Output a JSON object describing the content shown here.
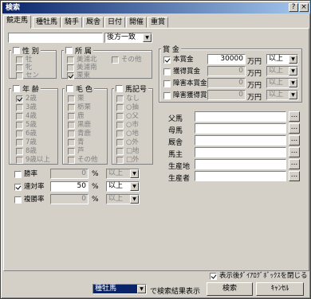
{
  "window": {
    "title": "検索"
  },
  "tabs": [
    {
      "label": "競走馬",
      "active": true
    },
    {
      "label": "種牡馬"
    },
    {
      "label": "騎手"
    },
    {
      "label": "厩舎"
    },
    {
      "label": "日付"
    },
    {
      "label": "開催"
    },
    {
      "label": "重賞"
    }
  ],
  "name_search": {
    "value": "",
    "match_mode": "後方一致"
  },
  "sex": {
    "title": "性 別",
    "items": [
      "牡",
      "牝",
      "セン"
    ]
  },
  "region": {
    "title": "所 属",
    "items": [
      "美浦北",
      "美浦南",
      "栗東",
      "その他"
    ],
    "checked": [
      "栗東"
    ]
  },
  "age": {
    "title": "年 齢",
    "items": [
      "2歳",
      "3歳",
      "4歳",
      "5歳",
      "6歳",
      "7歳",
      "8歳",
      "9歳以上"
    ],
    "checked": [
      "2歳"
    ]
  },
  "coat": {
    "title": "毛 色",
    "items": [
      "栗",
      "栃栗",
      "鹿",
      "黒鹿",
      "青鹿",
      "青",
      "芦",
      "その他"
    ]
  },
  "mark": {
    "title": "馬記号",
    "items": [
      "なし",
      "○抽",
      "○父",
      "○市",
      "○地",
      "○外",
      "□地",
      "□外"
    ]
  },
  "rates": [
    {
      "label": "勝率",
      "value": "0",
      "unit": "%",
      "cmp": "以上",
      "checked": false
    },
    {
      "label": "連対率",
      "value": "50",
      "unit": "%",
      "cmp": "以上",
      "checked": true
    },
    {
      "label": "複勝率",
      "value": "0",
      "unit": "%",
      "cmp": "以上",
      "checked": false
    }
  ],
  "prize": {
    "title": "賞 金",
    "rows": [
      {
        "label": "本賞金",
        "value": "30000",
        "unit": "万円",
        "cmp": "以上",
        "checked": true
      },
      {
        "label": "獲得賞金",
        "value": "0",
        "unit": "万円",
        "cmp": "以上",
        "checked": false
      },
      {
        "label": "障害本賞金",
        "value": "0",
        "unit": "万円",
        "cmp": "以上",
        "checked": false
      },
      {
        "label": "障害獲得賞金",
        "value": "0",
        "unit": "万円",
        "cmp": "以上",
        "checked": false
      }
    ]
  },
  "pedigree": {
    "rows": [
      {
        "label": "父馬",
        "value": ""
      },
      {
        "label": "母馬",
        "value": ""
      },
      {
        "label": "厩舎",
        "value": ""
      },
      {
        "label": "馬主",
        "value": ""
      },
      {
        "label": "生産地",
        "value": ""
      },
      {
        "label": "生産者",
        "value": ""
      }
    ],
    "browse_label": "..."
  },
  "close_dialog": {
    "label": "表示後ﾀﾞｲｱﾛｸﾞﾎﾞｯｸｽを閉じる",
    "checked": true
  },
  "footer": {
    "result_target": "種牡馬",
    "result_suffix": "で検索結果表示",
    "search_label": "検索",
    "cancel_label": "ｷｬﾝｾﾙ"
  }
}
